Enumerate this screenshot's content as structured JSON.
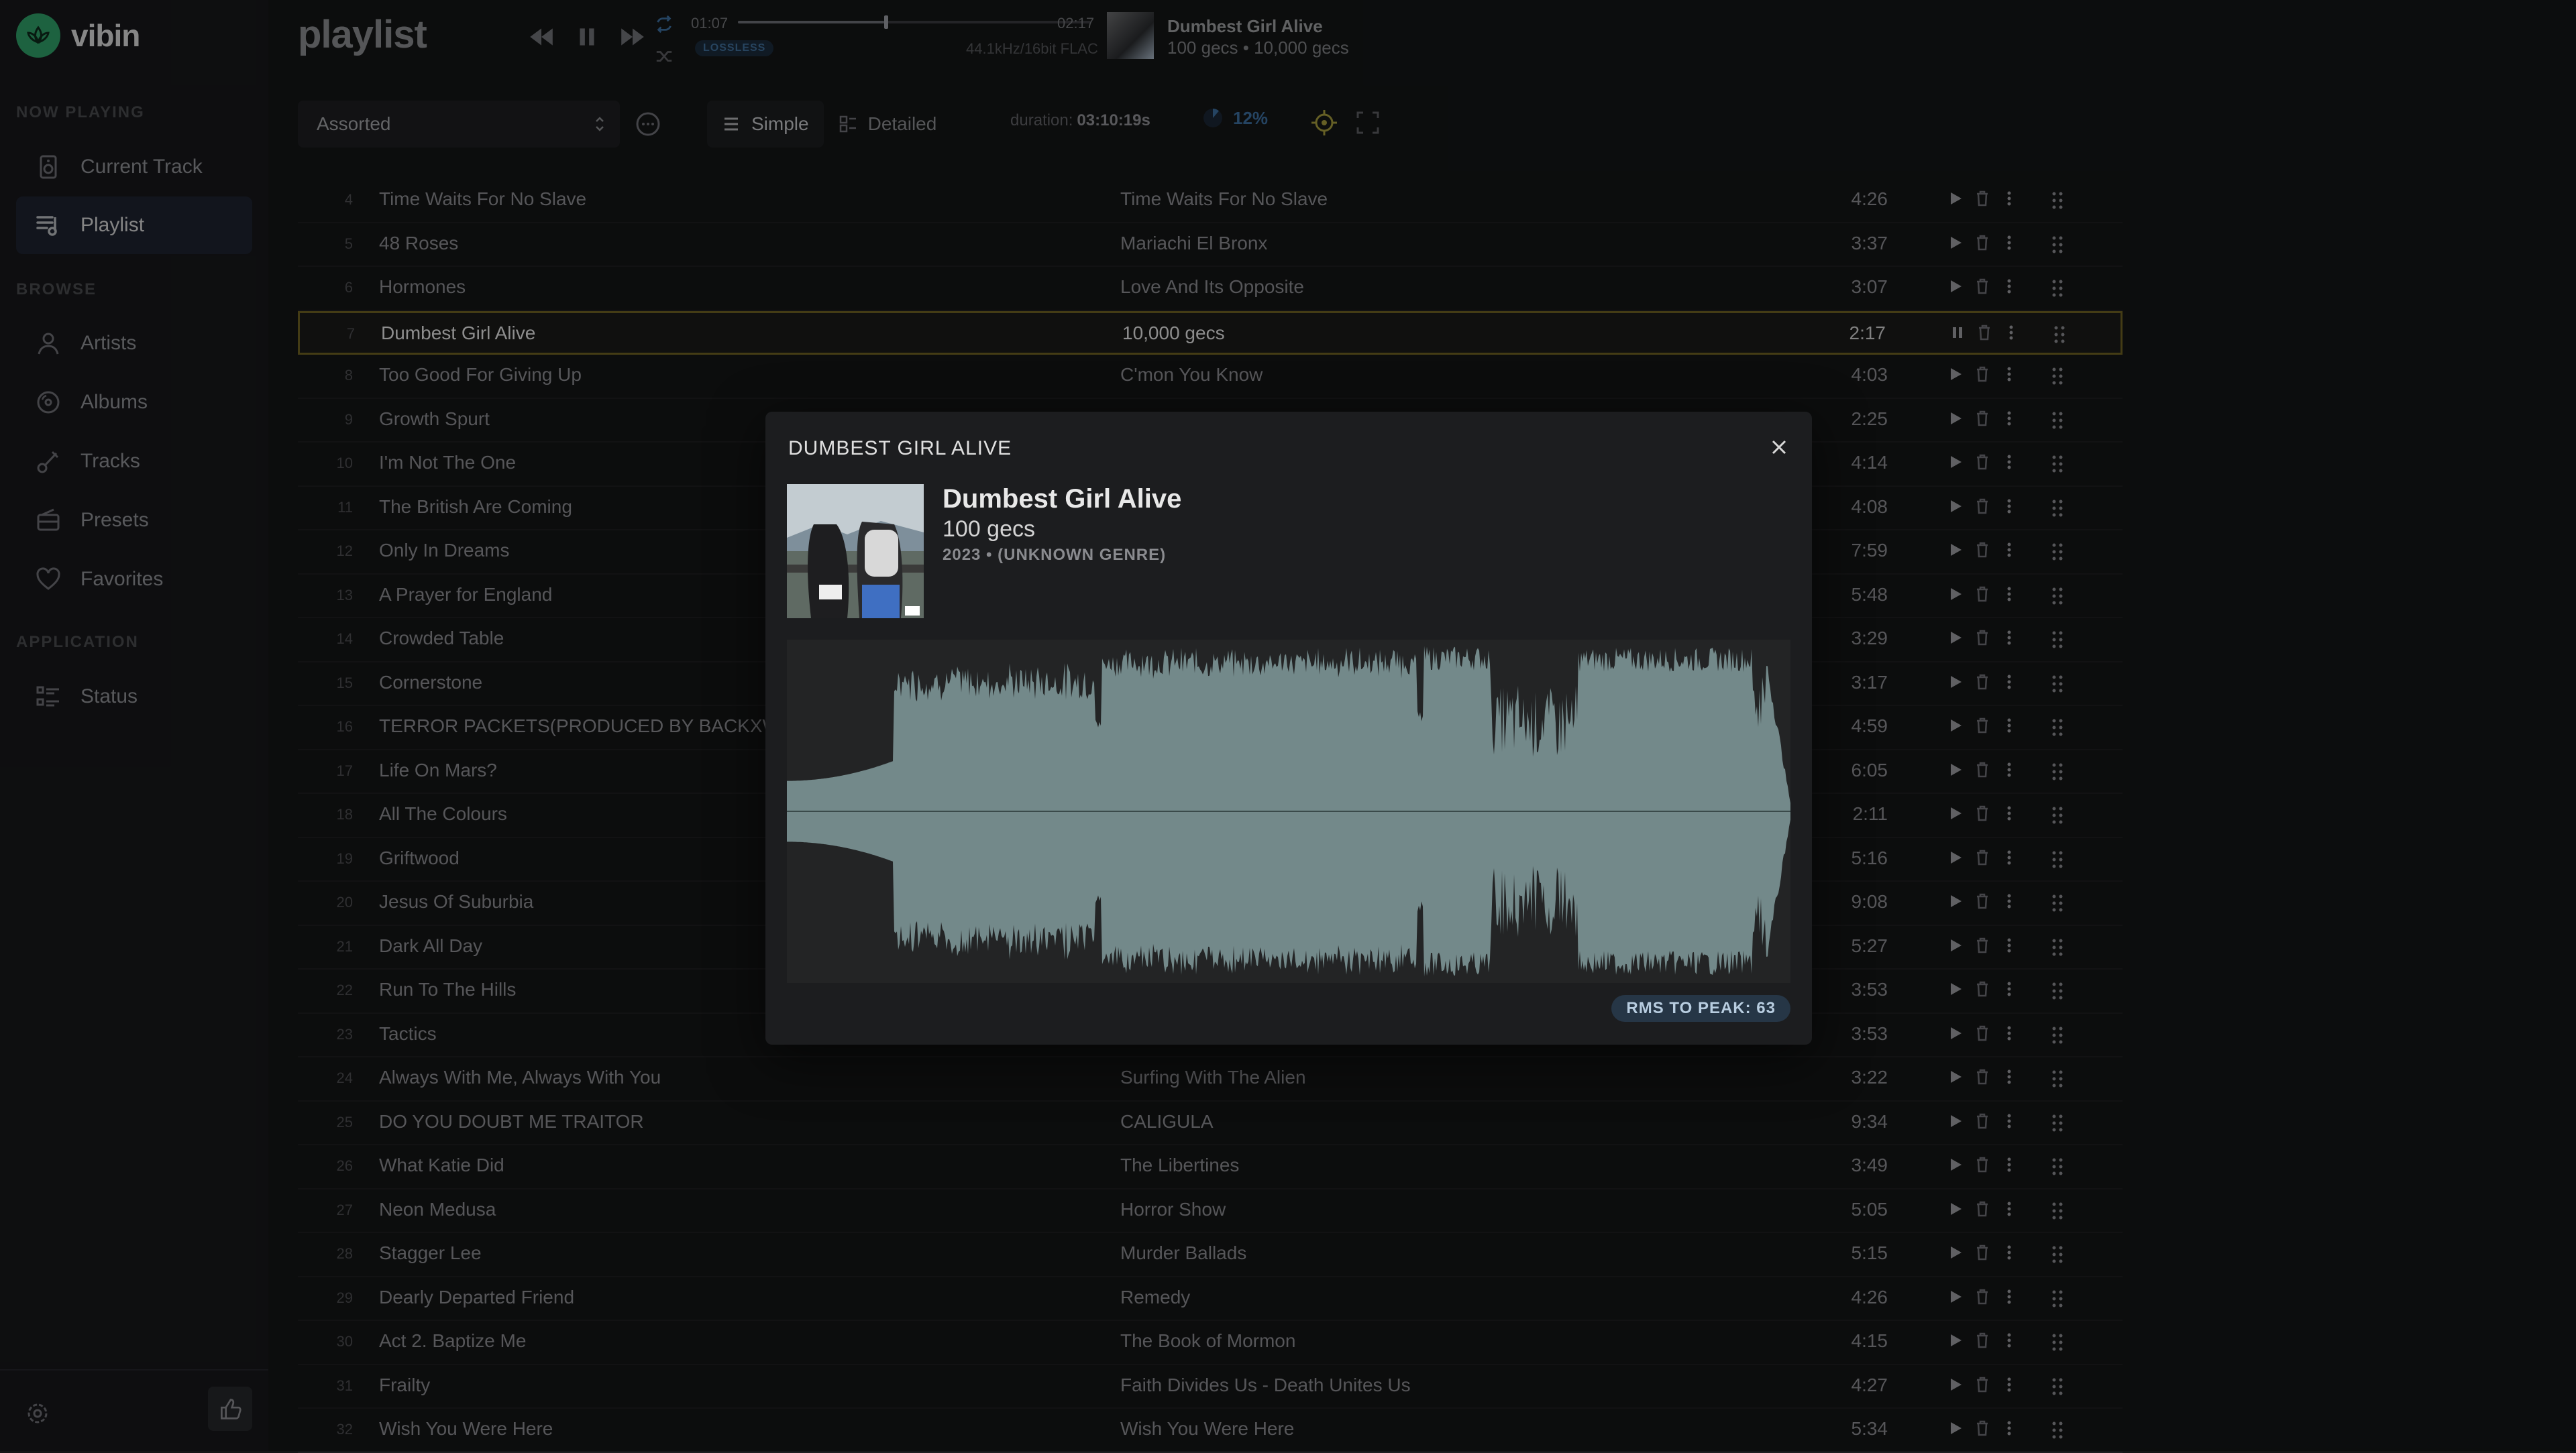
{
  "app": {
    "name": "vibin"
  },
  "sidebar": {
    "sections": {
      "now_playing": "NOW PLAYING",
      "browse": "BROWSE",
      "application": "APPLICATION"
    },
    "items": [
      {
        "label": "Current Track",
        "icon": "speaker-icon"
      },
      {
        "label": "Playlist",
        "icon": "playlist-icon"
      },
      {
        "label": "Artists",
        "icon": "user-icon"
      },
      {
        "label": "Albums",
        "icon": "disc-icon"
      },
      {
        "label": "Tracks",
        "icon": "music-note-icon"
      },
      {
        "label": "Presets",
        "icon": "radio-icon"
      },
      {
        "label": "Favorites",
        "icon": "heart-icon"
      },
      {
        "label": "Status",
        "icon": "list-icon"
      }
    ]
  },
  "header": {
    "title": "playlist",
    "time_elapsed": "01:07",
    "time_total": "02:17",
    "progress_fraction": 0.415,
    "lossless_badge": "LOSSLESS",
    "format": "44.1kHz/16bit FLAC",
    "now_playing": {
      "title": "Dumbest Girl Alive",
      "artist_album": "100 gecs • 10,000 gecs"
    }
  },
  "toolbar": {
    "playlist_select": "Assorted",
    "view_simple": "Simple",
    "view_detailed": "Detailed",
    "duration_label": "duration:",
    "duration_value": "03:10:19s",
    "progress_pct": "12%"
  },
  "rows": [
    {
      "n": "4",
      "title": "Time Waits For No Slave",
      "album": "Time Waits For No Slave",
      "dur": "4:26"
    },
    {
      "n": "5",
      "title": "48 Roses",
      "album": "Mariachi El Bronx",
      "dur": "3:37"
    },
    {
      "n": "6",
      "title": "Hormones",
      "album": "Love And Its Opposite",
      "dur": "3:07"
    },
    {
      "n": "7",
      "title": "Dumbest Girl Alive",
      "album": "10,000 gecs",
      "dur": "2:17",
      "selected": true
    },
    {
      "n": "8",
      "title": "Too Good For Giving Up",
      "album": "C'mon You Know",
      "dur": "4:03"
    },
    {
      "n": "9",
      "title": "Growth Spurt",
      "album": "",
      "dur": "2:25"
    },
    {
      "n": "10",
      "title": "I'm Not The One",
      "album": "",
      "dur": "4:14"
    },
    {
      "n": "11",
      "title": "The British Are Coming",
      "album": "",
      "dur": "4:08"
    },
    {
      "n": "12",
      "title": "Only In Dreams",
      "album": "",
      "dur": "7:59"
    },
    {
      "n": "13",
      "title": "A Prayer for England",
      "album": "",
      "dur": "5:48"
    },
    {
      "n": "14",
      "title": "Crowded Table",
      "album": "",
      "dur": "3:29"
    },
    {
      "n": "15",
      "title": "Cornerstone",
      "album": "",
      "dur": "3:17"
    },
    {
      "n": "16",
      "title": "TERROR PACKETS(PRODUCED BY BACKXWA",
      "album": "",
      "dur": "4:59"
    },
    {
      "n": "17",
      "title": "Life On Mars?",
      "album": "",
      "dur": "6:05"
    },
    {
      "n": "18",
      "title": "All The Colours",
      "album": "",
      "dur": "2:11"
    },
    {
      "n": "19",
      "title": "Griftwood",
      "album": "",
      "dur": "5:16"
    },
    {
      "n": "20",
      "title": "Jesus Of Suburbia",
      "album": "",
      "dur": "9:08"
    },
    {
      "n": "21",
      "title": "Dark All Day",
      "album": "",
      "dur": "5:27"
    },
    {
      "n": "22",
      "title": "Run To The Hills",
      "album": "",
      "dur": "3:53"
    },
    {
      "n": "23",
      "title": "Tactics",
      "album": "",
      "dur": "3:53"
    },
    {
      "n": "24",
      "title": "Always With Me, Always With You",
      "album": "Surfing With The Alien",
      "dur": "3:22"
    },
    {
      "n": "25",
      "title": "DO YOU DOUBT ME TRAITOR",
      "album": "CALIGULA",
      "dur": "9:34"
    },
    {
      "n": "26",
      "title": "What Katie Did",
      "album": "The Libertines",
      "dur": "3:49"
    },
    {
      "n": "27",
      "title": "Neon Medusa",
      "album": "Horror Show",
      "dur": "5:05"
    },
    {
      "n": "28",
      "title": "Stagger Lee",
      "album": "Murder Ballads",
      "dur": "5:15"
    },
    {
      "n": "29",
      "title": "Dearly Departed Friend",
      "album": "Remedy",
      "dur": "4:26"
    },
    {
      "n": "30",
      "title": "Act 2. Baptize Me",
      "album": "The Book of Mormon",
      "dur": "4:15"
    },
    {
      "n": "31",
      "title": "Frailty",
      "album": "Faith Divides Us - Death Unites Us",
      "dur": "4:27"
    },
    {
      "n": "32",
      "title": "Wish You Were Here",
      "album": "Wish You Were Here",
      "dur": "5:34"
    }
  ],
  "modal": {
    "heading": "DUMBEST GIRL ALIVE",
    "title": "Dumbest Girl Alive",
    "artist": "100 gecs",
    "meta": "2023 • (UNKNOWN GENRE)",
    "rms": "RMS TO PEAK: 63"
  },
  "colors": {
    "accent": "#2f9e68",
    "selected_border": "#6e6222",
    "waveform": "#73898a"
  }
}
